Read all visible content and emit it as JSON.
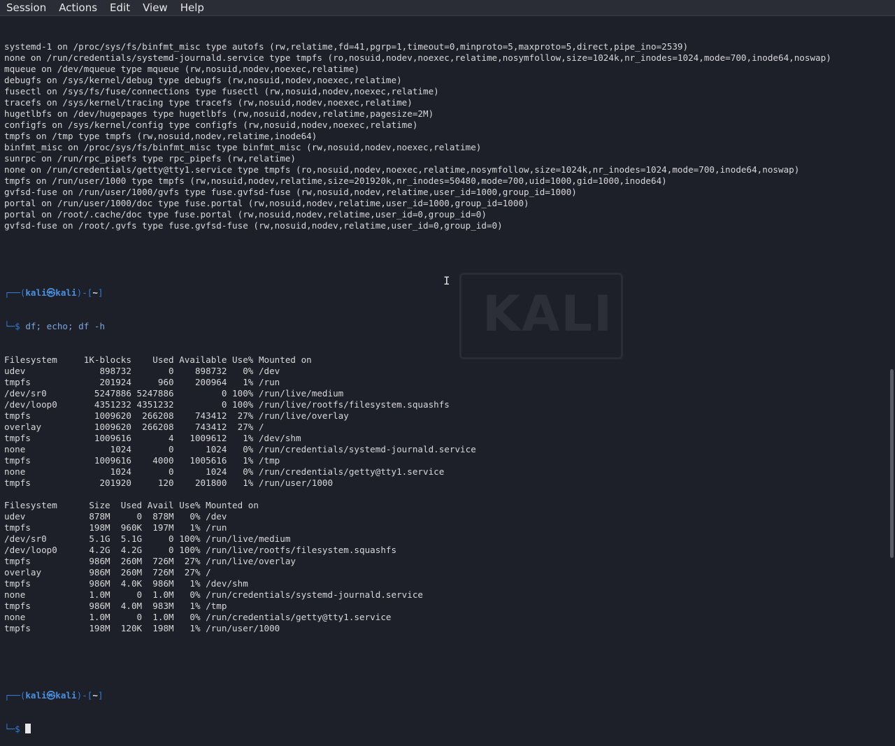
{
  "menu": [
    "Session",
    "Actions",
    "Edit",
    "View",
    "Help"
  ],
  "wallpaper": {
    "logo_text": "KALI"
  },
  "output_top": [
    "systemd-1 on /proc/sys/fs/binfmt_misc type autofs (rw,relatime,fd=41,pgrp=1,timeout=0,minproto=5,maxproto=5,direct,pipe_ino=2539)",
    "none on /run/credentials/systemd-journald.service type tmpfs (ro,nosuid,nodev,noexec,relatime,nosymfollow,size=1024k,nr_inodes=1024,mode=700,inode64,noswap)",
    "mqueue on /dev/mqueue type mqueue (rw,nosuid,nodev,noexec,relatime)",
    "debugfs on /sys/kernel/debug type debugfs (rw,nosuid,nodev,noexec,relatime)",
    "fusectl on /sys/fs/fuse/connections type fusectl (rw,nosuid,nodev,noexec,relatime)",
    "tracefs on /sys/kernel/tracing type tracefs (rw,nosuid,nodev,noexec,relatime)",
    "hugetlbfs on /dev/hugepages type hugetlbfs (rw,nosuid,nodev,relatime,pagesize=2M)",
    "configfs on /sys/kernel/config type configfs (rw,nosuid,nodev,noexec,relatime)",
    "tmpfs on /tmp type tmpfs (rw,nosuid,nodev,relatime,inode64)",
    "binfmt_misc on /proc/sys/fs/binfmt_misc type binfmt_misc (rw,nosuid,nodev,noexec,relatime)",
    "sunrpc on /run/rpc_pipefs type rpc_pipefs (rw,relatime)",
    "none on /run/credentials/getty@tty1.service type tmpfs (ro,nosuid,nodev,noexec,relatime,nosymfollow,size=1024k,nr_inodes=1024,mode=700,inode64,noswap)",
    "tmpfs on /run/user/1000 type tmpfs (rw,nosuid,nodev,relatime,size=201920k,nr_inodes=50480,mode=700,uid=1000,gid=1000,inode64)",
    "gvfsd-fuse on /run/user/1000/gvfs type fuse.gvfsd-fuse (rw,nosuid,nodev,relatime,user_id=1000,group_id=1000)",
    "portal on /run/user/1000/doc type fuse.portal (rw,nosuid,nodev,relatime,user_id=1000,group_id=1000)",
    "portal on /root/.cache/doc type fuse.portal (rw,nosuid,nodev,relatime,user_id=0,group_id=0)",
    "gvfsd-fuse on /root/.gvfs type fuse.gvfsd-fuse (rw,nosuid,nodev,relatime,user_id=0,group_id=0)"
  ],
  "prompt": {
    "corner_top": "┌──(",
    "user": "kali㉿kali",
    "mid": ")-[",
    "path": "~",
    "end": "]",
    "corner_bottom": "└─$ "
  },
  "command1": "df; echo; df -h",
  "df_output": [
    "Filesystem     1K-blocks    Used Available Use% Mounted on",
    "udev              898732       0    898732   0% /dev",
    "tmpfs             201924     960    200964   1% /run",
    "/dev/sr0         5247886 5247886         0 100% /run/live/medium",
    "/dev/loop0       4351232 4351232         0 100% /run/live/rootfs/filesystem.squashfs",
    "tmpfs            1009620  266208    743412  27% /run/live/overlay",
    "overlay          1009620  266208    743412  27% /",
    "tmpfs            1009616       4   1009612   1% /dev/shm",
    "none                1024       0      1024   0% /run/credentials/systemd-journald.service",
    "tmpfs            1009616    4000   1005616   1% /tmp",
    "none                1024       0      1024   0% /run/credentials/getty@tty1.service",
    "tmpfs             201920     120    201800   1% /run/user/1000",
    "",
    "Filesystem      Size  Used Avail Use% Mounted on",
    "udev            878M     0  878M   0% /dev",
    "tmpfs           198M  960K  197M   1% /run",
    "/dev/sr0        5.1G  5.1G     0 100% /run/live/medium",
    "/dev/loop0      4.2G  4.2G     0 100% /run/live/rootfs/filesystem.squashfs",
    "tmpfs           986M  260M  726M  27% /run/live/overlay",
    "overlay         986M  260M  726M  27% /",
    "tmpfs           986M  4.0K  986M   1% /dev/shm",
    "none            1.0M     0  1.0M   0% /run/credentials/systemd-journald.service",
    "tmpfs           986M  4.0M  983M   1% /tmp",
    "none            1.0M     0  1.0M   0% /run/credentials/getty@tty1.service",
    "tmpfs           198M  120K  198M   1% /run/user/1000"
  ]
}
